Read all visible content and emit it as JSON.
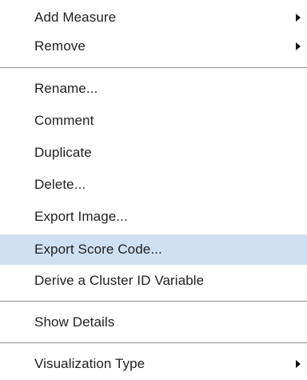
{
  "menu": {
    "items": [
      {
        "label": "Add Measure",
        "submenu": true
      },
      {
        "label": "Remove",
        "submenu": true
      },
      {
        "label": "Rename..."
      },
      {
        "label": "Comment"
      },
      {
        "label": "Duplicate"
      },
      {
        "label": "Delete..."
      },
      {
        "label": "Export Image..."
      },
      {
        "label": "Export Score Code...",
        "highlighted": true
      },
      {
        "label": "Derive a Cluster ID Variable"
      },
      {
        "label": "Show Details"
      },
      {
        "label": "Visualization Type",
        "submenu": true
      }
    ],
    "colors": {
      "highlight": "#cfe0f3",
      "text": "#1f1f1f",
      "separator": "#8a8a8a"
    }
  }
}
